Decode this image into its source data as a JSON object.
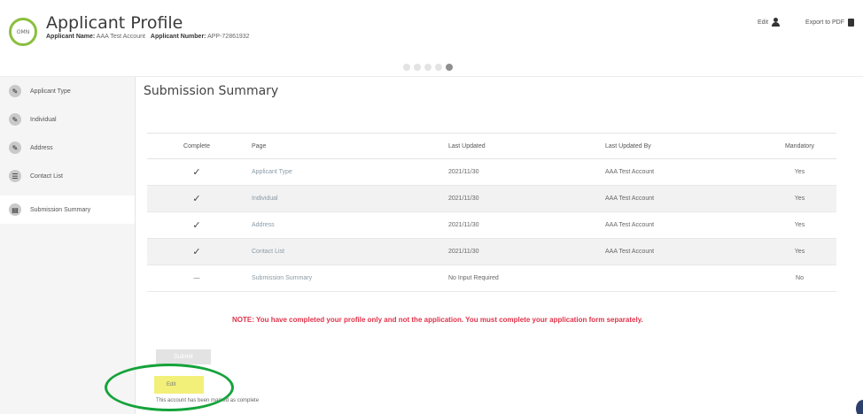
{
  "header": {
    "logo_text": "OMN",
    "title": "Applicant Profile",
    "applicant_name_label": "Applicant Name:",
    "applicant_name_value": "AAA Test Account",
    "applicant_number_label": "Applicant Number:",
    "applicant_number_value": "APP-72861932",
    "edit_label": "Edit",
    "export_label": "Export to PDF"
  },
  "progress": {
    "total_steps": 5,
    "active_step": 5
  },
  "sidebar": {
    "items": [
      {
        "label": "Applicant Type",
        "icon": "pencil-icon"
      },
      {
        "label": "Individual",
        "icon": "pencil-icon"
      },
      {
        "label": "Address",
        "icon": "pencil-icon"
      },
      {
        "label": "Contact List",
        "icon": "list-icon"
      },
      {
        "label": "Submission Summary",
        "icon": "summary-icon"
      }
    ],
    "active_index": 4
  },
  "main": {
    "title": "Submission Summary",
    "table": {
      "headers": [
        "Complete",
        "Page",
        "Last Updated",
        "Last Updated By",
        "Mandatory"
      ],
      "rows": [
        {
          "complete": "✓",
          "page": "Applicant Type",
          "last_updated": "2021/11/30",
          "last_updated_by": "AAA Test Account",
          "mandatory": "Yes"
        },
        {
          "complete": "✓",
          "page": "Individual",
          "last_updated": "2021/11/30",
          "last_updated_by": "AAA Test Account",
          "mandatory": "Yes"
        },
        {
          "complete": "✓",
          "page": "Address",
          "last_updated": "2021/11/30",
          "last_updated_by": "AAA Test Account",
          "mandatory": "Yes"
        },
        {
          "complete": "✓",
          "page": "Contact List",
          "last_updated": "2021/11/30",
          "last_updated_by": "AAA Test Account",
          "mandatory": "Yes"
        },
        {
          "complete": "—",
          "page": "Submission Summary",
          "last_updated": "No Input Required",
          "last_updated_by": "",
          "mandatory": "No"
        }
      ]
    },
    "note": "NOTE: You have completed your profile only and not the application. You must complete your application form separately.",
    "submit_button_label": "Submit",
    "edit_button_label": "Edit",
    "status_text": "This account has been marked as complete"
  },
  "colors": {
    "accent_green": "#8bbf3e",
    "note_red": "#e0334a",
    "highlight_yellow": "#f3f07a",
    "annotation_green": "#14a33a"
  }
}
